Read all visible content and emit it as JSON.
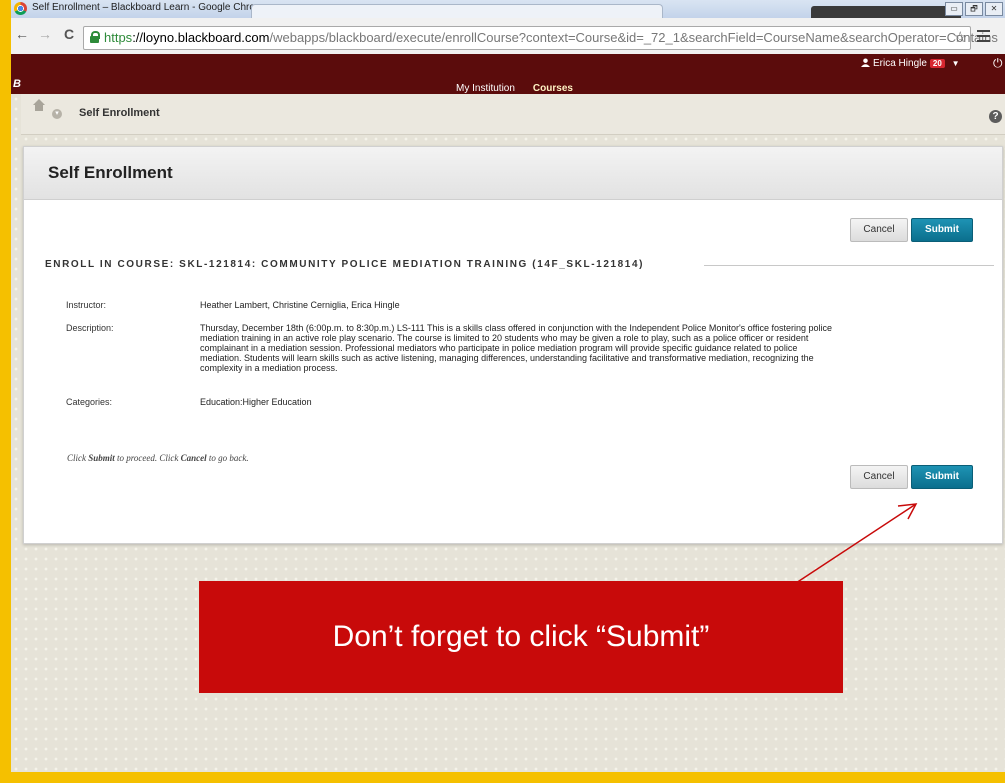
{
  "window": {
    "title": "Self Enrollment – Blackboard Learn - Google Chrome",
    "controls": [
      "▭",
      "🗗",
      "✕"
    ]
  },
  "toolbar": {
    "back": "←",
    "forward": "→",
    "reload": "C",
    "url_scheme": "https",
    "url_host": "://loyno.blackboard.com",
    "url_path": "/webapps/blackboard/execute/enrollCourse?context=Course&id=_72_1&searchField=CourseName&searchOperator=Contains",
    "star": "☆"
  },
  "header": {
    "logo": "B",
    "user_name": "Erica Hingle",
    "notification_count": "20",
    "dropdown": "▼",
    "power": "⏻",
    "tabs": [
      "My Institution",
      "Courses"
    ]
  },
  "breadcrumb": {
    "current": "Self Enrollment",
    "help": "?"
  },
  "panel": {
    "title": "Self Enrollment",
    "cancel_label": "Cancel",
    "submit_label": "Submit",
    "section_heading": "ENROLL IN COURSE: SKL-121814: COMMUNITY POLICE MEDIATION TRAINING (14F_SKL-121814)",
    "fields": {
      "instructor_label": "Instructor:",
      "instructor_value": "Heather Lambert, Christine Cerniglia, Erica Hingle",
      "description_label": "Description:",
      "description_value": "Thursday, December 18th  (6:00p.m. to 8:30p.m.) LS-111 This is a skills class offered in conjunction with the Independent Police Monitor's office fostering police\nmediation training in an active role play scenario.  The course is limited to 20 students who may be given a role to play, such as a police officer or resident\ncomplainant in a mediation session.  Professional mediators who participate in police mediation program will provide specific guidance related to police\nmediation.  Students will learn skills such as active listening, managing differences, understanding facilitative and transformative mediation, recognizing the\ncomplexity in a mediation process.",
      "categories_label": "Categories:",
      "categories_value": "Education:Higher Education"
    },
    "instructions": {
      "part1": "Click ",
      "submit_word": "Submit",
      "part2": " to proceed. Click ",
      "cancel_word": "Cancel",
      "part3": " to go back."
    }
  },
  "callout": {
    "text": "Don’t forget to click “Submit”",
    "color": "#c80a0a"
  },
  "colors": {
    "header_bg": "#5b0c0c",
    "submit_bg": "#0b6f8d",
    "slide_border": "#f5c000"
  }
}
